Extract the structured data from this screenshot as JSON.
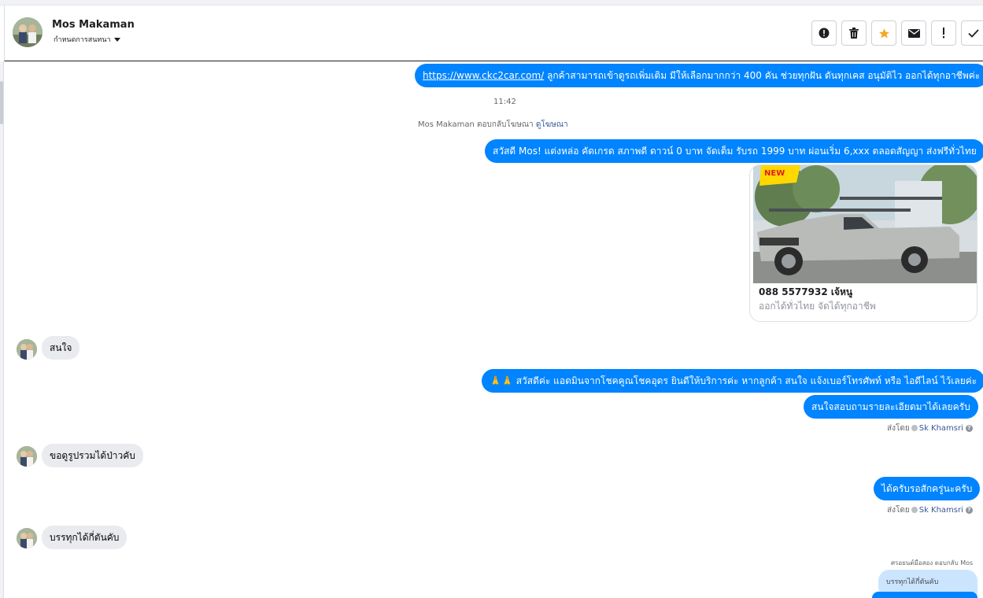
{
  "contact": {
    "name": "Mos Makaman",
    "subtitle": "กำหนดการสนทนา"
  },
  "toolbar": {
    "buttons": [
      "alert-circle-icon",
      "trash-icon",
      "star-icon",
      "envelope-icon",
      "exclamation-icon",
      "check-icon"
    ],
    "accent_star": "#f5a623"
  },
  "colors": {
    "outgoing_bubble": "#0084ff",
    "incoming_bubble": "#e9ebee",
    "link": "#385898"
  },
  "messages": {
    "m1_link": "https://www.ckc2car.com/",
    "m1_text": " ลูกค้าสามารถเข้าดูรถเพิ่มเติม มีให้เลือกมากกว่า 400 คัน ช่วยทุกฝัน ดันทุกเคส อนุมัติไว ออกได้ทุกอาชีพค่ะ",
    "time": "11:42",
    "ad_reply_prefix": "Mos Makaman ตอบกลับโฆษณา",
    "ad_reply_link": "ดูโฆษณา",
    "m2": "สวัสดี Mos! แต่งหล่อ คัดเกรด สภาพดี ดาวน์ 0 บาท จัดเต็ม รับรถ 1999 บาท ผ่อนเริ่ม 6,xxx ตลอดสัญญา ส่งฟรีทั่วไทย",
    "card_title": "088 5577932 เจ้หนู",
    "card_sub": "ออกได้ทั่วไทย จัดได้ทุกอาชีพ",
    "card_badge": "NEW",
    "in1": "สนใจ",
    "m3": "🙏🙏 สวัสดีค่ะ แอดมินจากโชคคูณโชคอุดร ยินดีให้บริการค่ะ หากลูกค้า สนใจ แจ้งเบอร์โทรศัพท์ หรือ ไอดีไลน์ ไว้เลยค่ะ",
    "m4": "สนใจสอบถามรายละเอียดมาได้เลยครับ",
    "sent_by_prefix": "ส่งโดย",
    "sent_by_name": "Sk Khamsri",
    "in2": "ขอดูรูปรวมได้ป่าวคับ",
    "m5": "ได้ครับรอสักครู่นะครับ",
    "in3": "บรรทุกได้กี่ตันคับ",
    "reply_header": "ศรอยนต์มือสอง ตอบกลับ Mos",
    "reply_quote": "บรรทุกได้กี่ตันคับ"
  }
}
